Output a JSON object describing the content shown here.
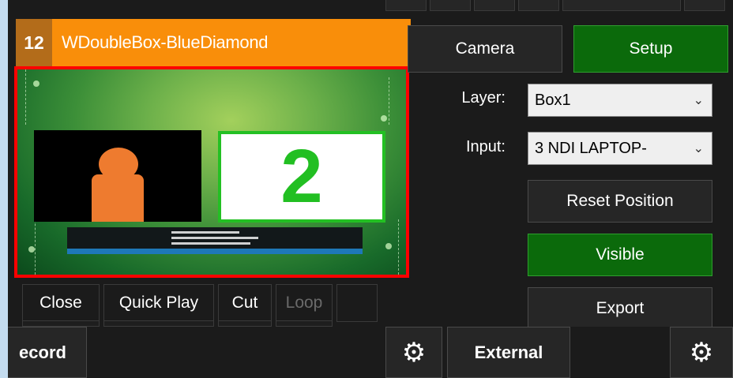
{
  "input": {
    "number": "12",
    "title": "WDoubleBox-BlueDiamond",
    "preview": {
      "number_display": "2"
    }
  },
  "controls": {
    "close": "Close",
    "quick_play": "Quick Play",
    "cut": "Cut",
    "loop": "Loop"
  },
  "tabs": {
    "camera": "Camera",
    "setup": "Setup"
  },
  "setup": {
    "layer_label": "Layer:",
    "layer_value": "Box1",
    "input_label": "Input:",
    "input_value": "3 NDI LAPTOP-",
    "reset_position": "Reset Position",
    "visible": "Visible",
    "export": "Export"
  },
  "bottom": {
    "record": "ecord",
    "external": "External"
  },
  "icons": {
    "gear": "gear-icon",
    "chevron": "chevron-down-icon"
  },
  "colors": {
    "title_bar": "#f98e0a",
    "selection_border": "#ff0000",
    "active_green": "#0b6a0b",
    "number_green": "#22bf22"
  }
}
